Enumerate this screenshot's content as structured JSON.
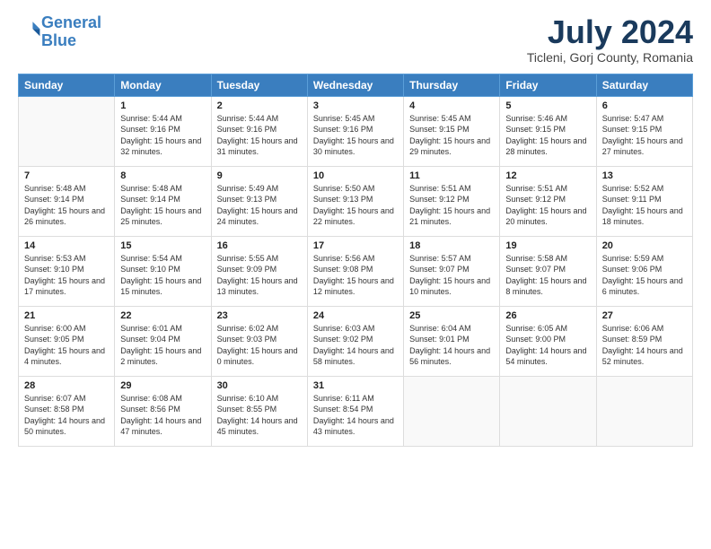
{
  "header": {
    "logo_line1": "General",
    "logo_line2": "Blue",
    "month_year": "July 2024",
    "location": "Ticleni, Gorj County, Romania"
  },
  "weekdays": [
    "Sunday",
    "Monday",
    "Tuesday",
    "Wednesday",
    "Thursday",
    "Friday",
    "Saturday"
  ],
  "weeks": [
    [
      {
        "day": "",
        "empty": true
      },
      {
        "day": "1",
        "sunrise": "5:44 AM",
        "sunset": "9:16 PM",
        "daylight": "15 hours and 32 minutes."
      },
      {
        "day": "2",
        "sunrise": "5:44 AM",
        "sunset": "9:16 PM",
        "daylight": "15 hours and 31 minutes."
      },
      {
        "day": "3",
        "sunrise": "5:45 AM",
        "sunset": "9:16 PM",
        "daylight": "15 hours and 30 minutes."
      },
      {
        "day": "4",
        "sunrise": "5:45 AM",
        "sunset": "9:15 PM",
        "daylight": "15 hours and 29 minutes."
      },
      {
        "day": "5",
        "sunrise": "5:46 AM",
        "sunset": "9:15 PM",
        "daylight": "15 hours and 28 minutes."
      },
      {
        "day": "6",
        "sunrise": "5:47 AM",
        "sunset": "9:15 PM",
        "daylight": "15 hours and 27 minutes."
      }
    ],
    [
      {
        "day": "7",
        "sunrise": "5:48 AM",
        "sunset": "9:14 PM",
        "daylight": "15 hours and 26 minutes."
      },
      {
        "day": "8",
        "sunrise": "5:48 AM",
        "sunset": "9:14 PM",
        "daylight": "15 hours and 25 minutes."
      },
      {
        "day": "9",
        "sunrise": "5:49 AM",
        "sunset": "9:13 PM",
        "daylight": "15 hours and 24 minutes."
      },
      {
        "day": "10",
        "sunrise": "5:50 AM",
        "sunset": "9:13 PM",
        "daylight": "15 hours and 22 minutes."
      },
      {
        "day": "11",
        "sunrise": "5:51 AM",
        "sunset": "9:12 PM",
        "daylight": "15 hours and 21 minutes."
      },
      {
        "day": "12",
        "sunrise": "5:51 AM",
        "sunset": "9:12 PM",
        "daylight": "15 hours and 20 minutes."
      },
      {
        "day": "13",
        "sunrise": "5:52 AM",
        "sunset": "9:11 PM",
        "daylight": "15 hours and 18 minutes."
      }
    ],
    [
      {
        "day": "14",
        "sunrise": "5:53 AM",
        "sunset": "9:10 PM",
        "daylight": "15 hours and 17 minutes."
      },
      {
        "day": "15",
        "sunrise": "5:54 AM",
        "sunset": "9:10 PM",
        "daylight": "15 hours and 15 minutes."
      },
      {
        "day": "16",
        "sunrise": "5:55 AM",
        "sunset": "9:09 PM",
        "daylight": "15 hours and 13 minutes."
      },
      {
        "day": "17",
        "sunrise": "5:56 AM",
        "sunset": "9:08 PM",
        "daylight": "15 hours and 12 minutes."
      },
      {
        "day": "18",
        "sunrise": "5:57 AM",
        "sunset": "9:07 PM",
        "daylight": "15 hours and 10 minutes."
      },
      {
        "day": "19",
        "sunrise": "5:58 AM",
        "sunset": "9:07 PM",
        "daylight": "15 hours and 8 minutes."
      },
      {
        "day": "20",
        "sunrise": "5:59 AM",
        "sunset": "9:06 PM",
        "daylight": "15 hours and 6 minutes."
      }
    ],
    [
      {
        "day": "21",
        "sunrise": "6:00 AM",
        "sunset": "9:05 PM",
        "daylight": "15 hours and 4 minutes."
      },
      {
        "day": "22",
        "sunrise": "6:01 AM",
        "sunset": "9:04 PM",
        "daylight": "15 hours and 2 minutes."
      },
      {
        "day": "23",
        "sunrise": "6:02 AM",
        "sunset": "9:03 PM",
        "daylight": "15 hours and 0 minutes."
      },
      {
        "day": "24",
        "sunrise": "6:03 AM",
        "sunset": "9:02 PM",
        "daylight": "14 hours and 58 minutes."
      },
      {
        "day": "25",
        "sunrise": "6:04 AM",
        "sunset": "9:01 PM",
        "daylight": "14 hours and 56 minutes."
      },
      {
        "day": "26",
        "sunrise": "6:05 AM",
        "sunset": "9:00 PM",
        "daylight": "14 hours and 54 minutes."
      },
      {
        "day": "27",
        "sunrise": "6:06 AM",
        "sunset": "8:59 PM",
        "daylight": "14 hours and 52 minutes."
      }
    ],
    [
      {
        "day": "28",
        "sunrise": "6:07 AM",
        "sunset": "8:58 PM",
        "daylight": "14 hours and 50 minutes."
      },
      {
        "day": "29",
        "sunrise": "6:08 AM",
        "sunset": "8:56 PM",
        "daylight": "14 hours and 47 minutes."
      },
      {
        "day": "30",
        "sunrise": "6:10 AM",
        "sunset": "8:55 PM",
        "daylight": "14 hours and 45 minutes."
      },
      {
        "day": "31",
        "sunrise": "6:11 AM",
        "sunset": "8:54 PM",
        "daylight": "14 hours and 43 minutes."
      },
      {
        "day": "",
        "empty": true
      },
      {
        "day": "",
        "empty": true
      },
      {
        "day": "",
        "empty": true
      }
    ]
  ]
}
